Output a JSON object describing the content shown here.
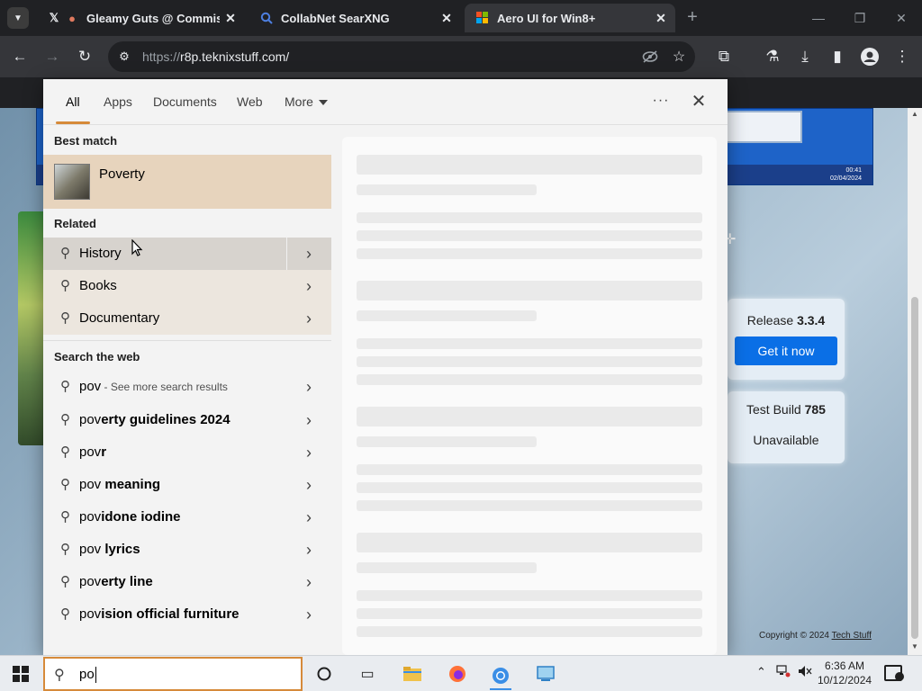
{
  "browser": {
    "tabs": [
      {
        "title": "Gleamy Guts @ Commission",
        "favicon": "x-logo-icon"
      },
      {
        "title": "CollabNet SearXNG",
        "favicon": "search-icon"
      },
      {
        "title": "Aero UI for Win8+",
        "favicon": "windows-logo-icon"
      }
    ],
    "url_scheme": "https://",
    "url_rest": "r8p.teknixstuff.com/"
  },
  "page": {
    "release_label": "Release",
    "release_version": "3.3.4",
    "get_button": "Get it now",
    "test_build_label": "Test Build",
    "test_build_number": "785",
    "test_build_status": "Unavailable",
    "copyright_prefix": "Copyright © 2024",
    "copyright_link": "Tech Stuff",
    "screenshot_clock_time": "00:41",
    "screenshot_clock_date": "02/04/2024"
  },
  "search": {
    "tabs": [
      "All",
      "Apps",
      "Documents",
      "Web",
      "More"
    ],
    "best_match_heading": "Best match",
    "best_match": "Poverty",
    "related_heading": "Related",
    "related": [
      "History",
      "Books",
      "Documentary"
    ],
    "web_heading": "Search the web",
    "web_first_query": "pov",
    "web_first_sub": " - See more search results",
    "web": [
      {
        "prefix": "pov",
        "suffix": "erty guidelines 2024"
      },
      {
        "prefix": "pov",
        "suffix": "r"
      },
      {
        "prefix": "pov",
        "suffix": " meaning"
      },
      {
        "prefix": "pov",
        "suffix": "idone iodine"
      },
      {
        "prefix": "pov",
        "suffix": " lyrics"
      },
      {
        "prefix": "pov",
        "suffix": "erty line"
      },
      {
        "prefix": "pov",
        "suffix": "ision official furniture"
      }
    ],
    "query": "po"
  },
  "taskbar": {
    "time": "6:36 AM",
    "date": "10/12/2024"
  },
  "colors": {
    "accent": "#d68a3a",
    "best_match_bg": "#e7d4bd",
    "button_blue": "#0a6fe6"
  }
}
